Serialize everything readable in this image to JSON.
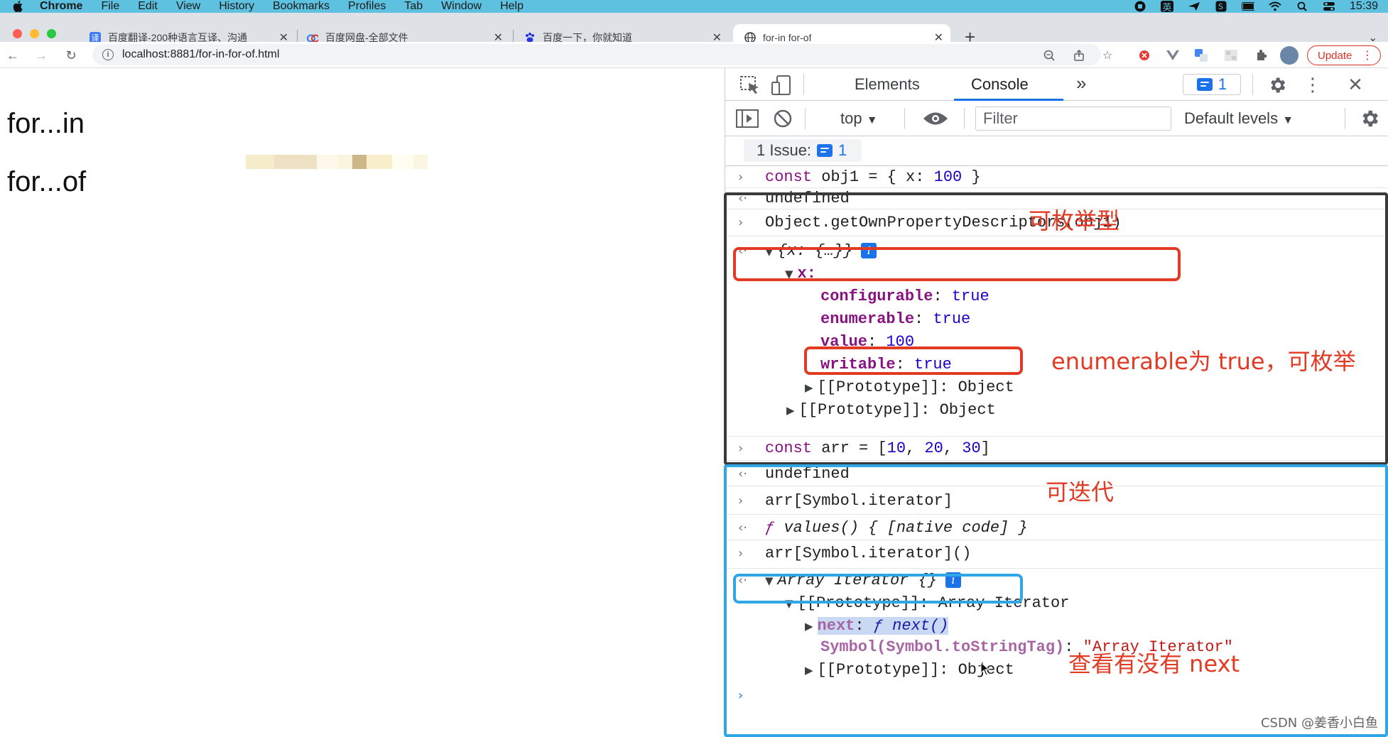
{
  "menubar": {
    "app": "Chrome",
    "items": [
      "File",
      "Edit",
      "View",
      "History",
      "Bookmarks",
      "Profiles",
      "Tab",
      "Window",
      "Help"
    ],
    "ime_label": "英",
    "clock": "15:39"
  },
  "tabs": [
    {
      "title": "百度翻译-200种语言互译、沟通",
      "icon": "translate-icon"
    },
    {
      "title": "百度网盘-全部文件",
      "icon": "cloud-drive-icon"
    },
    {
      "title": "百度一下，你就知道",
      "icon": "baidu-paw-icon"
    },
    {
      "title": "for-in for-of",
      "icon": "globe-icon",
      "active": true
    }
  ],
  "toolbar": {
    "url": "localhost:8881/for-in-for-of.html",
    "update_label": "Update"
  },
  "page": {
    "heading1": "for...in",
    "heading2": "for...of"
  },
  "devtools": {
    "tab_elements": "Elements",
    "tab_console": "Console",
    "more_tabs": "»",
    "issues_badge_count": "1",
    "context": "top",
    "filter_placeholder": "Filter",
    "levels": "Default levels",
    "issues_label": "1 Issue:",
    "issues_count": "1"
  },
  "console": {
    "l1": {
      "kw": "const",
      "rest1": " obj1 = { x: ",
      "num": "100",
      "rest2": " }"
    },
    "l2": "undefined",
    "l3": "Object.getOwnPropertyDescriptors(obj1)",
    "l4": "{x: {…}}",
    "l5": "x:",
    "l6": {
      "key": "configurable",
      "val": "true"
    },
    "l7": {
      "key": "enumerable",
      "val": "true"
    },
    "l8": {
      "key": "value",
      "val": "100"
    },
    "l9": {
      "key": "writable",
      "val": "true"
    },
    "l10": "[[Prototype]]: Object",
    "l11": "[[Prototype]]: Object",
    "l12": {
      "kw": "const",
      "rest1": " arr = [",
      "n1": "10",
      "c1": ", ",
      "n2": "20",
      "c2": ", ",
      "n3": "30",
      "rest2": "]"
    },
    "l13": "undefined",
    "l14": "arr[Symbol.iterator]",
    "l15": {
      "f": "ƒ",
      "rest": " values() { [native code] }"
    },
    "l16": "arr[Symbol.iterator]()",
    "l17": "Array Iterator {}",
    "l18": "[[Prototype]]: Array Iterator",
    "l19": {
      "key": "next",
      "colon": ": ",
      "f": "ƒ",
      "rest": " next()"
    },
    "l20": {
      "key": "Symbol(Symbol.toStringTag)",
      "colon": ": ",
      "val": "\"Array Iterator\""
    },
    "l21": "[[Prototype]]: Object"
  },
  "annotations": {
    "enumerable_type": "可枚举型",
    "enumerable_true": "enumerable为 true，可枚举",
    "iterable": "可迭代",
    "check_next": "查看有没有 next"
  },
  "watermark": "CSDN @姜香小白鱼"
}
